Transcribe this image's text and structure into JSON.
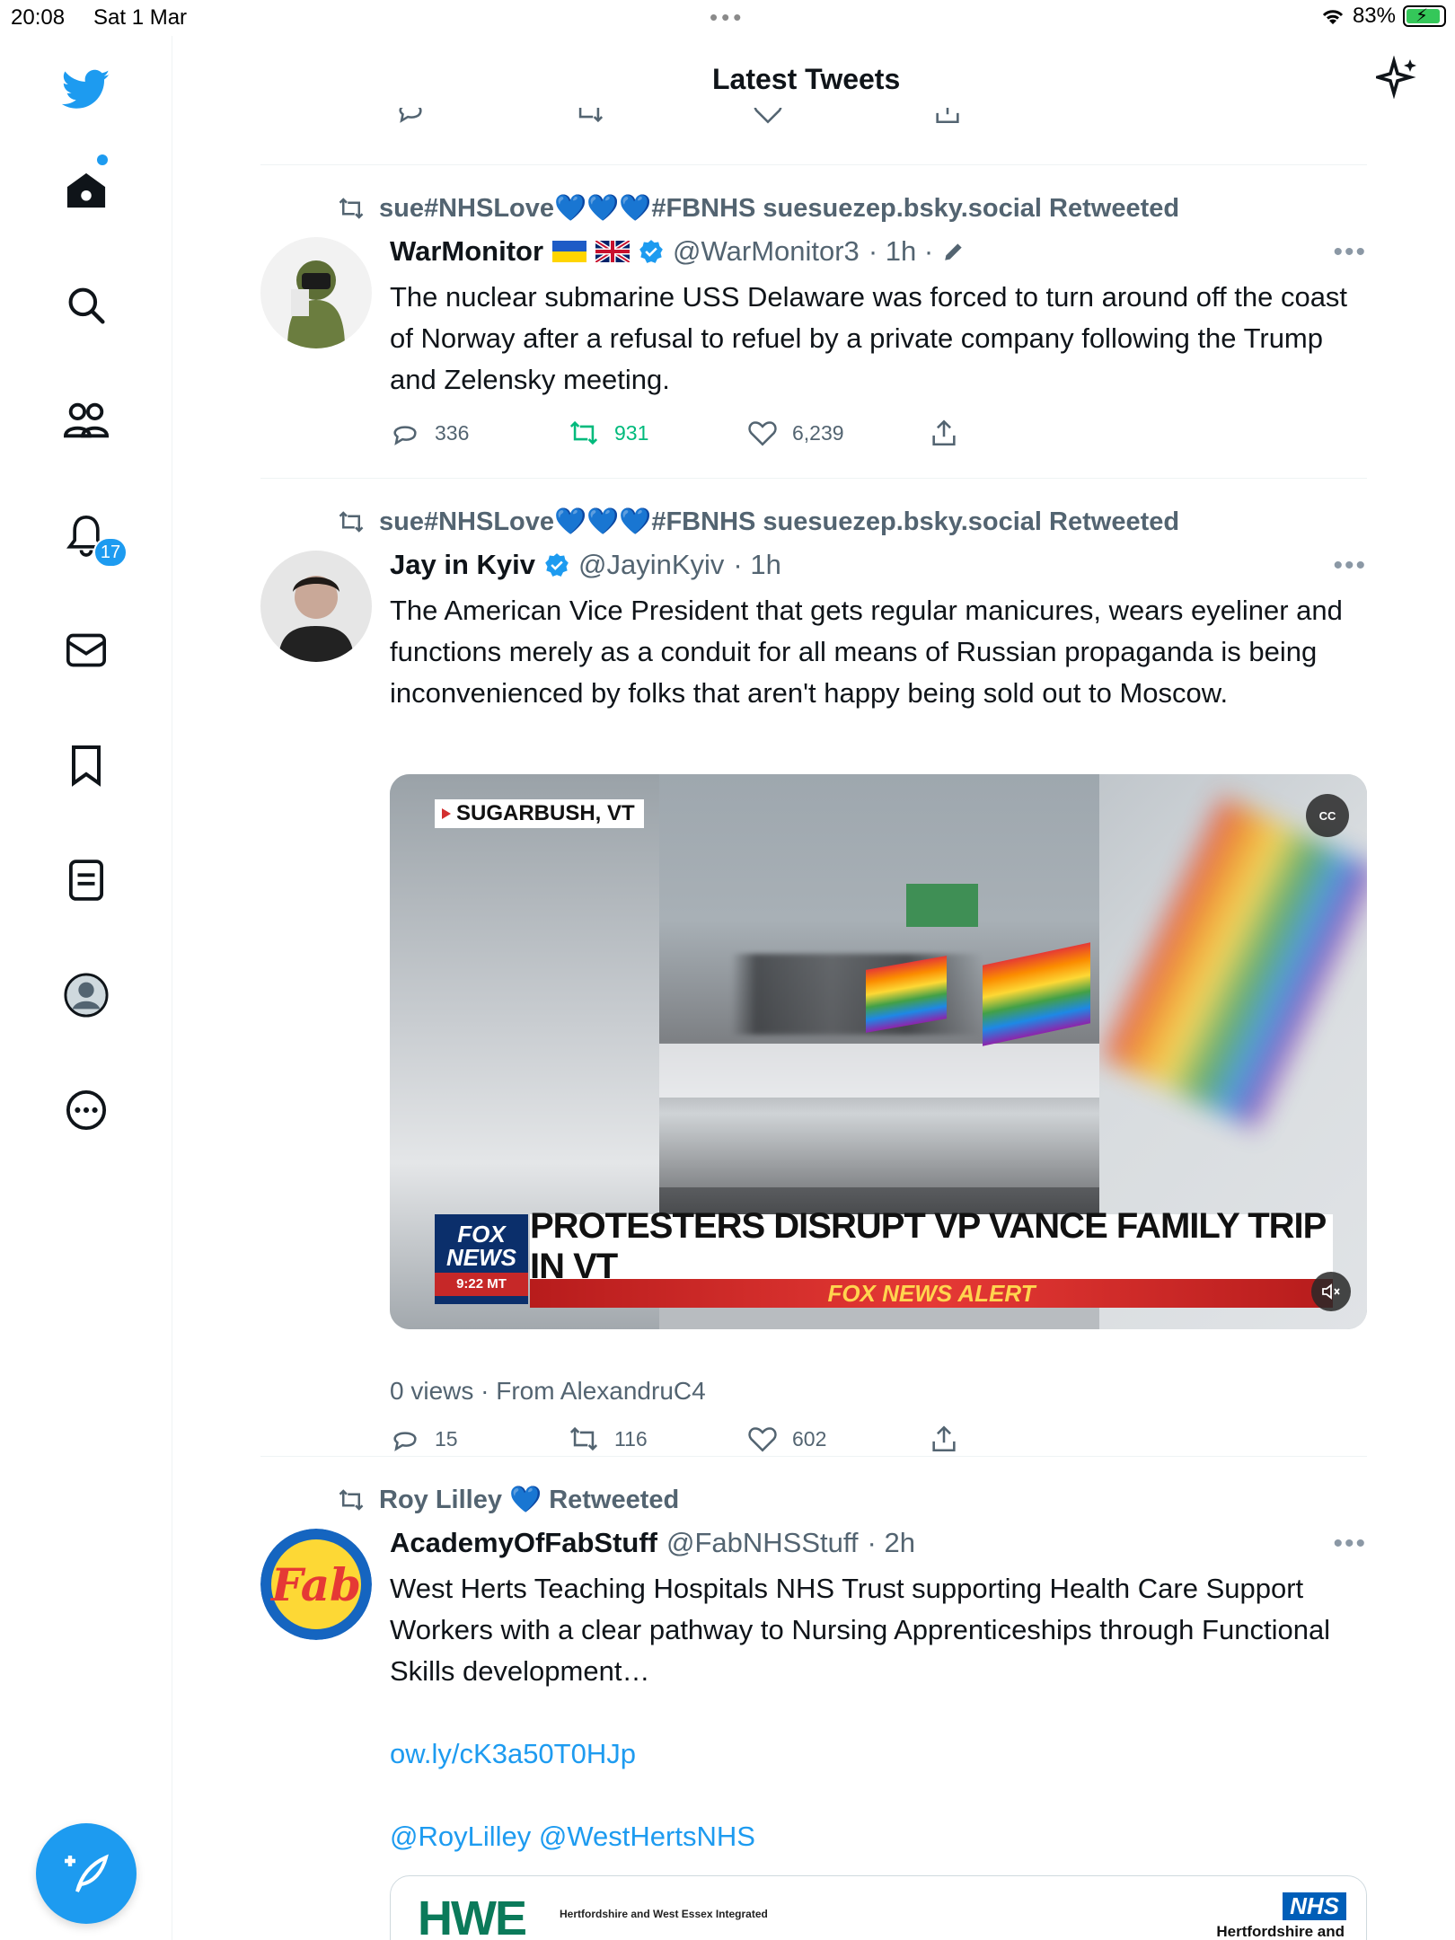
{
  "status_bar": {
    "time": "20:08",
    "date": "Sat 1 Mar",
    "battery": "83%"
  },
  "sidebar": {
    "notifications_count": "17"
  },
  "header": {
    "title": "Latest Tweets"
  },
  "tweets": [
    {
      "retweeted_by": "sue#NHSLove💙💙💙#FBNHS suesuezep.bsky.social Retweeted",
      "name": "WarMonitor",
      "handle": "@WarMonitor3",
      "time": "· 1h ·",
      "text": "The nuclear submarine USS Delaware was forced to turn around off the coast of Norway after a refusal to refuel by a private company following the Trump and Zelensky meeting.",
      "replies": "336",
      "retweets": "931",
      "likes": "6,239"
    },
    {
      "retweeted_by": "sue#NHSLove💙💙💙#FBNHS suesuezep.bsky.social Retweeted",
      "name": "Jay in Kyiv",
      "handle": "@JayinKyiv",
      "time": "· 1h",
      "text": "The American Vice President that gets regular manicures, wears eyeliner and functions merely as a conduit for all means of Russian propaganda is being inconvenienced by folks that aren't happy being sold out to Moscow.",
      "media": {
        "location": "SUGARBUSH, VT",
        "cc": "CC",
        "logo_line1": "FOX",
        "logo_line2": "NEWS",
        "logo_time": "9:22 MT",
        "headline": "PROTESTERS DISRUPT VP VANCE FAMILY TRIP IN VT",
        "alert": "FOX NEWS ALERT"
      },
      "views": "0 views · From AlexandruC4",
      "replies": "15",
      "retweets": "116",
      "likes": "602"
    },
    {
      "retweeted_by": "Roy Lilley 💙 Retweeted",
      "name": "AcademyOfFabStuff",
      "handle": "@FabNHSStuff",
      "time": "· 2h",
      "text": "West Herts Teaching Hospitals NHS Trust supporting Health Care Support Workers with a clear pathway to Nursing Apprenticeships through Functional Skills development…",
      "link": "ow.ly/cK3a50T0HJp",
      "mentions": "@RoyLilley @WestHertsNHS",
      "card": {
        "logo": "HWE",
        "logo_sub": "Hertfordshire and West Essex Integrated",
        "nhs": "NHS",
        "nhs_sub": "Hertfordshire and"
      }
    }
  ],
  "colors": {
    "accent": "#1d9bf0",
    "retweet_green": "#00ba7c",
    "secondary_text": "#536471"
  }
}
